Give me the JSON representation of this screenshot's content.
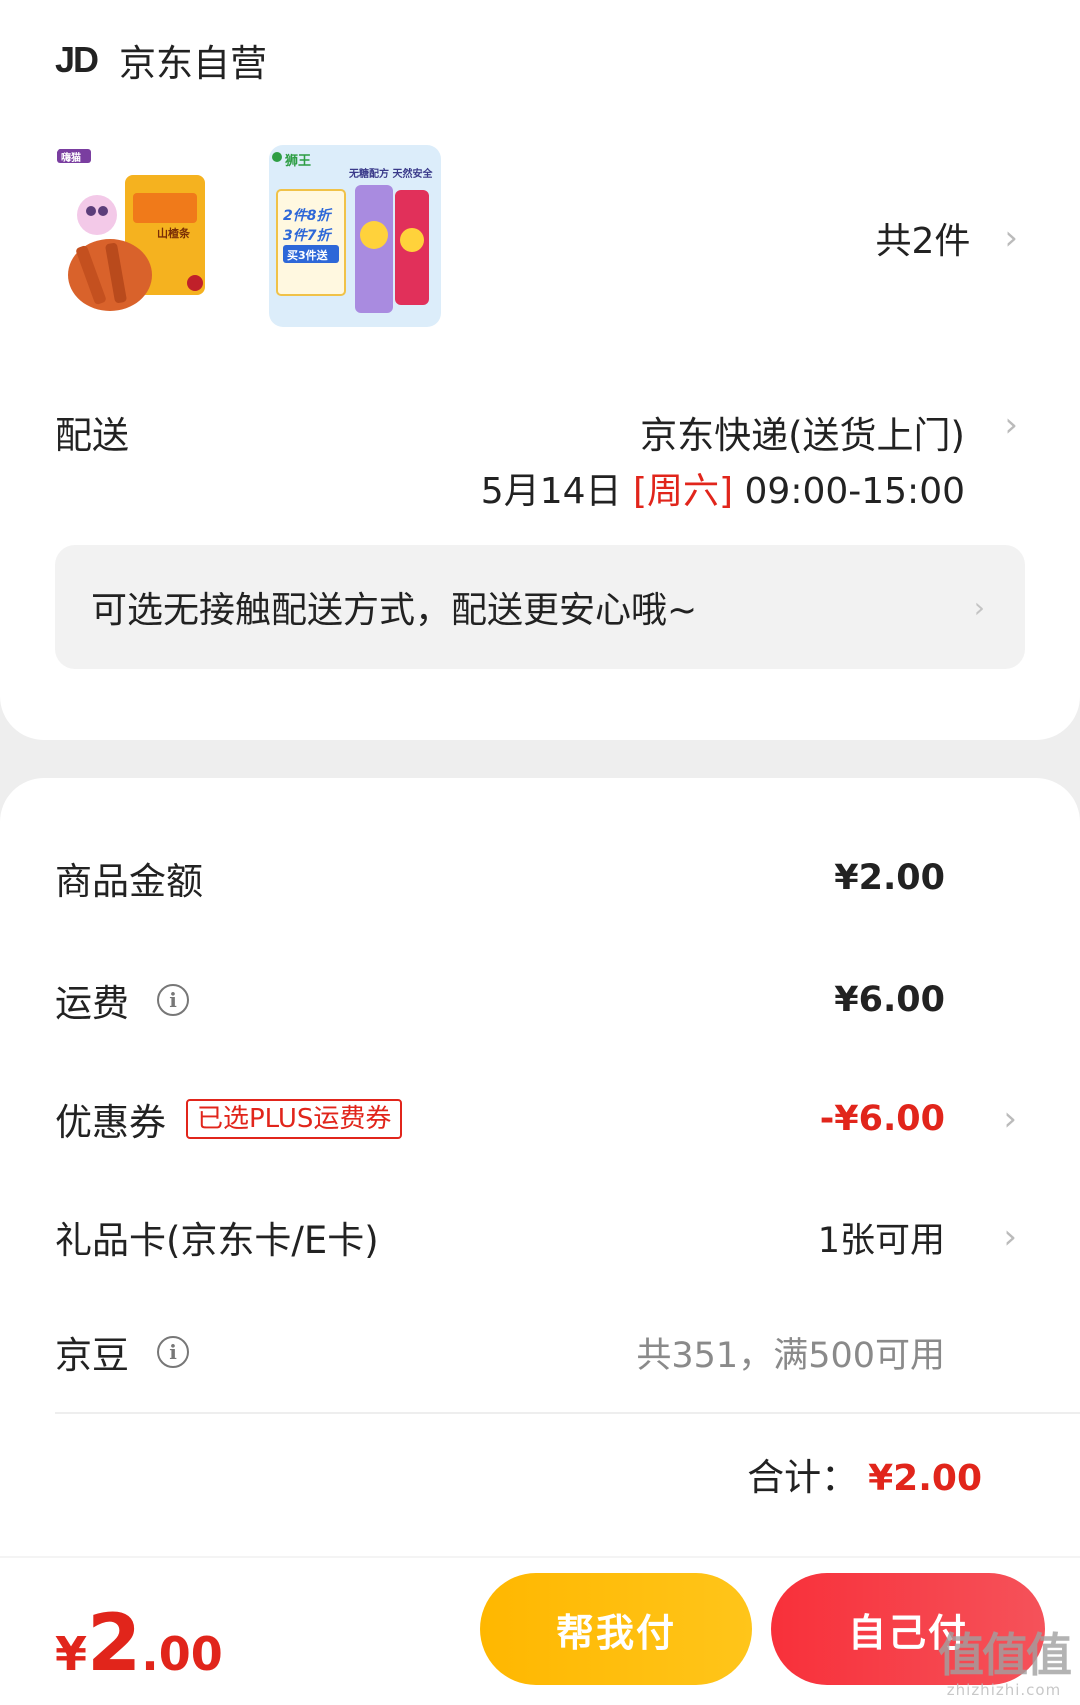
{
  "shop": {
    "logo": "JD",
    "name": "京东自营"
  },
  "products": {
    "item1_brand": "嗨猫",
    "item1_sub": "山楂条",
    "item2_brand": "狮王",
    "item2_slogan": "无糖配方 天然安全",
    "item2_promo_line1": "2件8折",
    "item2_promo_line2": "3件7折",
    "item2_promo_line3": "买3件送",
    "count": "共2件"
  },
  "delivery": {
    "label": "配送",
    "method": "京东快递(送货上门)",
    "date": "5月14日",
    "weekday": "[周六]",
    "time": "09:00-15:00",
    "notice": "可选无接触配送方式，配送更安心哦~"
  },
  "costs": {
    "goods_label": "商品金额",
    "goods_value": "¥2.00",
    "shipping_label": "运费",
    "shipping_value": "¥6.00",
    "coupon_label": "优惠券",
    "coupon_tag": "已选PLUS运费券",
    "coupon_value": "-¥6.00",
    "giftcard_label": "礼品卡(京东卡/E卡)",
    "giftcard_value": "1张可用",
    "jdbean_label": "京豆",
    "jdbean_value": "共351，满500可用",
    "total_label": "合计：",
    "total_value": "¥2.00"
  },
  "bottom": {
    "price_yen": "¥",
    "price_int": "2",
    "price_dec": ".00",
    "help_pay_label": "帮我付",
    "self_pay_label": "自己付"
  },
  "watermark": {
    "big": "值值值",
    "small": "zhizhizhi.com"
  },
  "icons": {
    "chevron": "chevron-right-icon",
    "info": "info-circle-icon"
  },
  "colors": {
    "accent_red": "#e1251b",
    "help_button": "#ffb700",
    "self_button": "#f8303a"
  }
}
